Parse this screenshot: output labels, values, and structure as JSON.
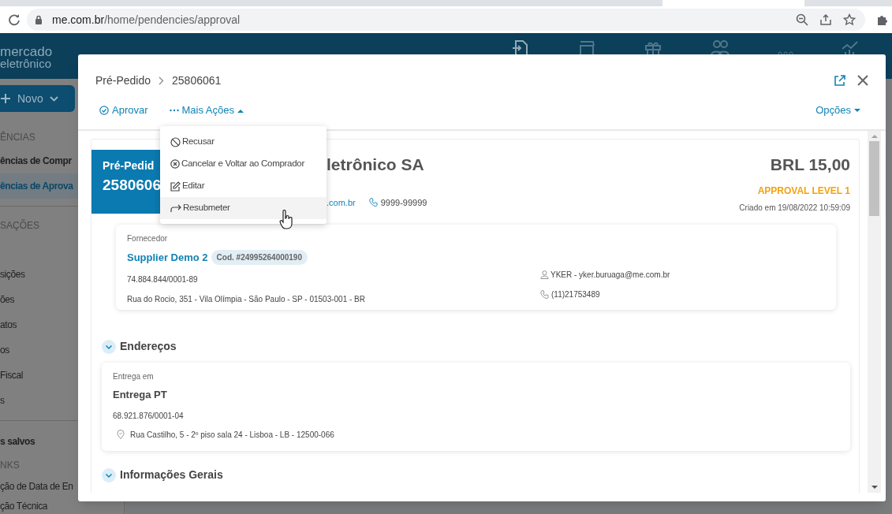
{
  "browser": {
    "url_host": "me.com.br",
    "url_path": "/home/pendencies/approval"
  },
  "app": {
    "logo": [
      "mercado",
      "eletrônico"
    ],
    "new_button": "Novo",
    "sidebar_groups": [
      {
        "items": [
          {
            "text": "ÊNCIAS",
            "kind": "heading"
          },
          {
            "text": "ências de Compr",
            "kind": "item",
            "selected": false
          },
          {
            "text": "ências de Aprova",
            "kind": "item",
            "selected": true
          }
        ]
      },
      {
        "items": [
          {
            "text": "SAÇÕES",
            "kind": "heading"
          },
          {
            "text": "sições",
            "kind": "item",
            "selected": false
          },
          {
            "text": "ões",
            "kind": "item",
            "selected": false
          },
          {
            "text": "atos",
            "kind": "item",
            "selected": false
          },
          {
            "text": "os",
            "kind": "item",
            "selected": false
          },
          {
            "text": "Fiscal",
            "kind": "item",
            "selected": false
          },
          {
            "text": "s",
            "kind": "item",
            "selected": false
          }
        ]
      },
      {
        "items": [
          {
            "text": "s salvos",
            "kind": "item",
            "selected": false
          },
          {
            "text": "NKS",
            "kind": "heading"
          },
          {
            "text": "ção de Data de En",
            "kind": "link"
          },
          {
            "text": "ção Técnica",
            "kind": "link"
          }
        ]
      }
    ]
  },
  "modal": {
    "breadcrumb": [
      "Pré-Pedido",
      "25806061"
    ],
    "toolbar": {
      "approve": "Aprovar",
      "more_actions": "Mais Ações",
      "options": "Opções"
    },
    "menu": [
      {
        "label": "Recusar",
        "hovered": false
      },
      {
        "label": "Cancelar e Voltar ao Comprador",
        "hovered": false
      },
      {
        "label": "Editar",
        "hovered": false
      },
      {
        "label": "Resubmeter",
        "hovered": true
      }
    ],
    "order": {
      "type": "Pré-Pedid",
      "number": "2580606",
      "buyer": "letrônico SA",
      "email": ".com.br",
      "phone": "9999-99999",
      "total": "BRL 15,00",
      "status": "APPROVAL LEVEL 1",
      "created": "Criado em 19/08/2022 10:59:09"
    },
    "supplier": {
      "label": "Fornecedor",
      "name": "Supplier Demo 2",
      "code": "Cod. #24995264000190",
      "tax_id": "74.884.844/0001-89",
      "address": "Rua do Rocio, 351 - Vila Olímpia - São Paulo - SP - 01503-001 - BR",
      "contact": "YKER - yker.buruaga@me.com.br",
      "phone": "(11)21753489"
    },
    "sections": [
      {
        "title": "Endereços",
        "expanded": true,
        "card": {
          "label": "Entrega em",
          "name": "Entrega PT",
          "tax_id": "68.921.876/0001-04",
          "address": "Rua Castilho, 5 - 2º piso sala 24 - Lisboa - LB - 12500-066"
        }
      },
      {
        "title": "Informações Gerais",
        "expanded": true
      }
    ]
  }
}
